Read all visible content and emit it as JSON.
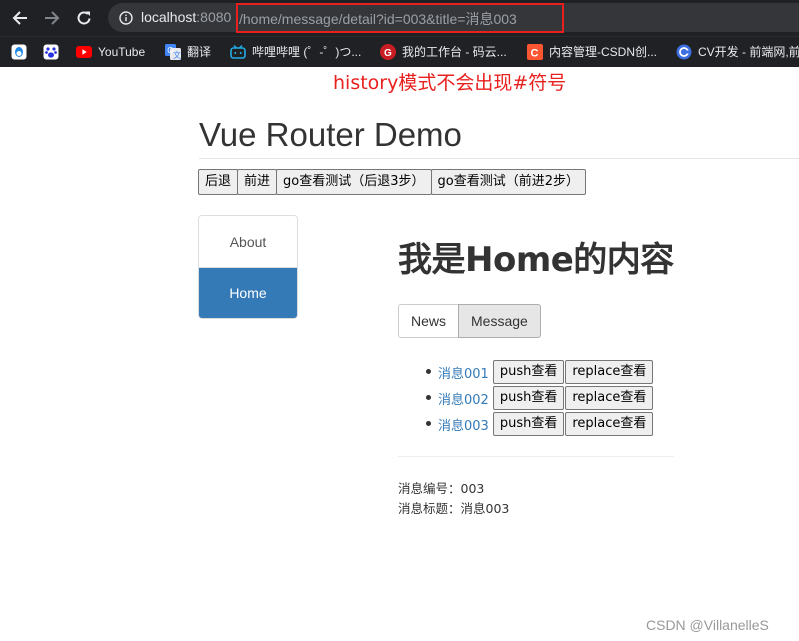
{
  "browser": {
    "url_host": "localhost",
    "url_port": ":8080",
    "url_path": "/home/message/detail?id=003&title=消息003",
    "bookmarks": [
      {
        "label": "",
        "icon": "qq-icon"
      },
      {
        "label": "",
        "icon": "baidu-paw-icon"
      },
      {
        "label": "YouTube",
        "icon": "youtube-icon"
      },
      {
        "label": "翻译",
        "icon": "google-translate-icon"
      },
      {
        "label": "哔哩哔哩 (゜-゜)つ...",
        "icon": "bilibili-icon"
      },
      {
        "label": "我的工作台 - 码云...",
        "icon": "gitee-icon"
      },
      {
        "label": "内容管理-CSDN创...",
        "icon": "csdn-icon"
      },
      {
        "label": "CV开发 - 前端网,前",
        "icon": "cv-icon"
      }
    ],
    "colors": {
      "chrome_bg": "#202124",
      "omnibox_bg": "#35363a",
      "highlight": "#e8201e"
    }
  },
  "annotation": "history模式不会出现#符号",
  "page": {
    "title": "Vue Router Demo",
    "buttons": [
      "后退",
      "前进",
      "go查看测试（后退3步）",
      "go查看测试（前进2步）"
    ],
    "sidebar": [
      {
        "label": "About",
        "active": false
      },
      {
        "label": "Home",
        "active": true
      }
    ],
    "home_heading": "我是Home的内容",
    "tabs": [
      {
        "label": "News",
        "active": false
      },
      {
        "label": "Message",
        "active": true
      }
    ],
    "messages": [
      {
        "title": "消息001",
        "push": "push查看",
        "replace": "replace查看"
      },
      {
        "title": "消息002",
        "push": "push查看",
        "replace": "replace查看"
      },
      {
        "title": "消息003",
        "push": "push查看",
        "replace": "replace查看"
      }
    ],
    "detail": {
      "id_label": "消息编号：003",
      "title_label": "消息标题：消息003"
    },
    "accent_color": "#337ab7"
  },
  "watermark": "CSDN @VillanelleS"
}
